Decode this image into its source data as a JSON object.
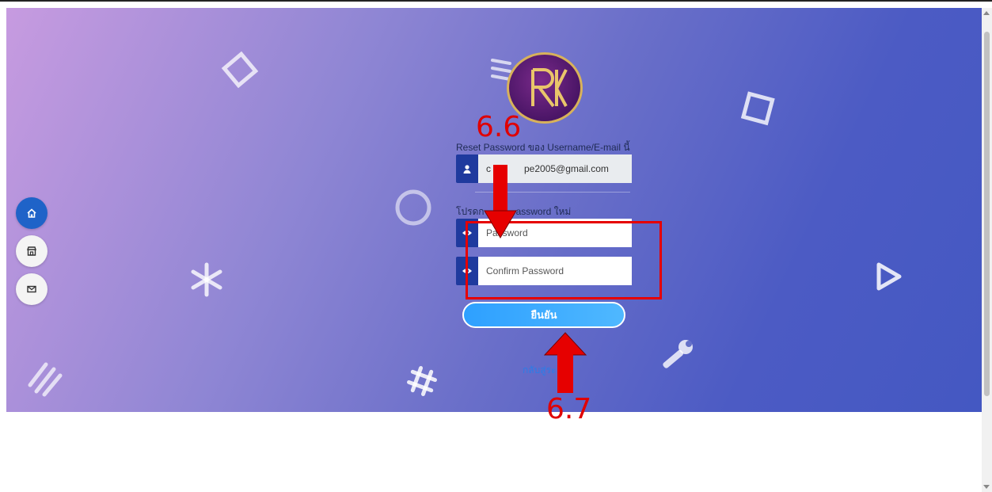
{
  "reset_caption": "Reset Password ของ Username/E-mail นี้",
  "email_value": "pe2005@gmail.com",
  "email_prefix": "c",
  "new_password_caption": "โปรดก",
  "new_password_caption_tail": "assword ใหม่",
  "password_placeholder": "Password",
  "confirm_placeholder": "Confirm Password",
  "confirm_button_label": "ยืนยัน",
  "back_link_label": "กลับสู่ระ",
  "annotations": {
    "step_a": "6.6",
    "step_b": "6.7"
  },
  "sidebar": {
    "items": [
      {
        "icon": "home-icon",
        "active": true
      },
      {
        "icon": "store-icon",
        "active": false
      },
      {
        "icon": "mail-icon",
        "active": false
      }
    ]
  },
  "colors": {
    "annotation": "#e60000",
    "input_icon_bg": "#1f3a9e",
    "button": "#2ea0ff"
  }
}
